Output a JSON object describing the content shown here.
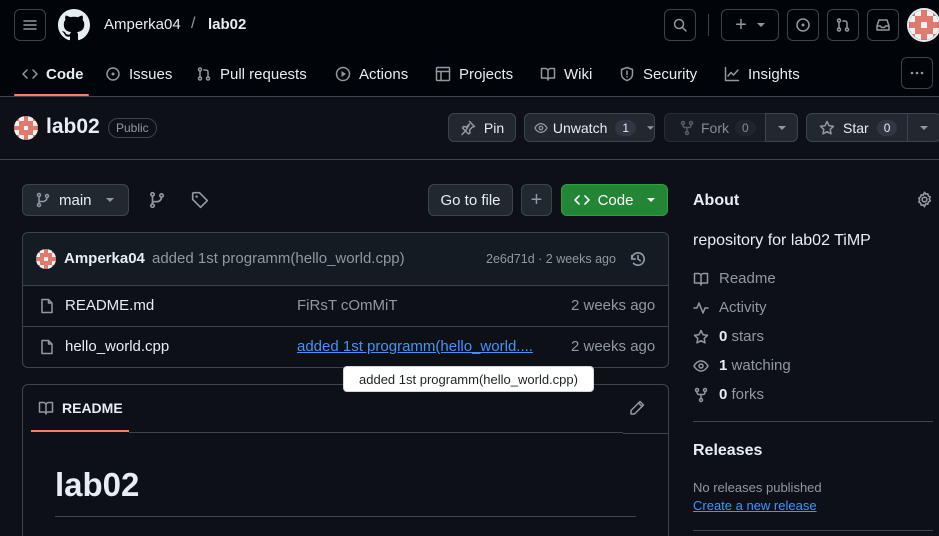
{
  "header": {
    "owner": "Amperka04",
    "separator": "/",
    "repo": "lab02",
    "new_label": "+"
  },
  "tabs": [
    {
      "label": "Code",
      "icon": "code-icon"
    },
    {
      "label": "Issues",
      "icon": "issue-icon"
    },
    {
      "label": "Pull requests",
      "icon": "pull-request-icon"
    },
    {
      "label": "Actions",
      "icon": "play-icon"
    },
    {
      "label": "Projects",
      "icon": "table-icon"
    },
    {
      "label": "Wiki",
      "icon": "book-icon"
    },
    {
      "label": "Security",
      "icon": "shield-icon"
    },
    {
      "label": "Insights",
      "icon": "graph-icon"
    }
  ],
  "repo_header": {
    "name": "lab02",
    "visibility": "Public",
    "pin": "Pin",
    "unwatch": "Unwatch",
    "watch_count": "1",
    "fork": "Fork",
    "fork_count": "0",
    "star": "Star",
    "star_count": "0"
  },
  "toolbar": {
    "branch": "main",
    "go_to_file": "Go to file",
    "add": "+",
    "code": "Code"
  },
  "commit": {
    "author": "Amperka04",
    "message": "added 1st programm(hello_world.cpp)",
    "sha_time": "2e6d71d · 2 weeks ago"
  },
  "files": [
    {
      "name": "README.md",
      "message": "FiRsT cOmMiT",
      "time": "2 weeks ago"
    },
    {
      "name": "hello_world.cpp",
      "message": "added 1st programm(hello_world....",
      "time": "2 weeks ago"
    }
  ],
  "tooltip": "added 1st programm(hello_world.cpp)",
  "readme": {
    "tab": "README",
    "heading": "lab02"
  },
  "about": {
    "title": "About",
    "description": "repository for lab02 TiMP",
    "readme": "Readme",
    "activity": "Activity",
    "stars_count": "0",
    "stars_label": "stars",
    "watching_count": "1",
    "watching_label": "watching",
    "forks_count": "0",
    "forks_label": "forks"
  },
  "releases": {
    "title": "Releases",
    "empty": "No releases published",
    "create_link": "Create a new release"
  },
  "colors": {
    "background": "#0d1117",
    "accent_green": "#238636",
    "link_blue": "#4493f8",
    "tab_underline": "#f78166",
    "avatar_pink": "#e07a6f"
  }
}
